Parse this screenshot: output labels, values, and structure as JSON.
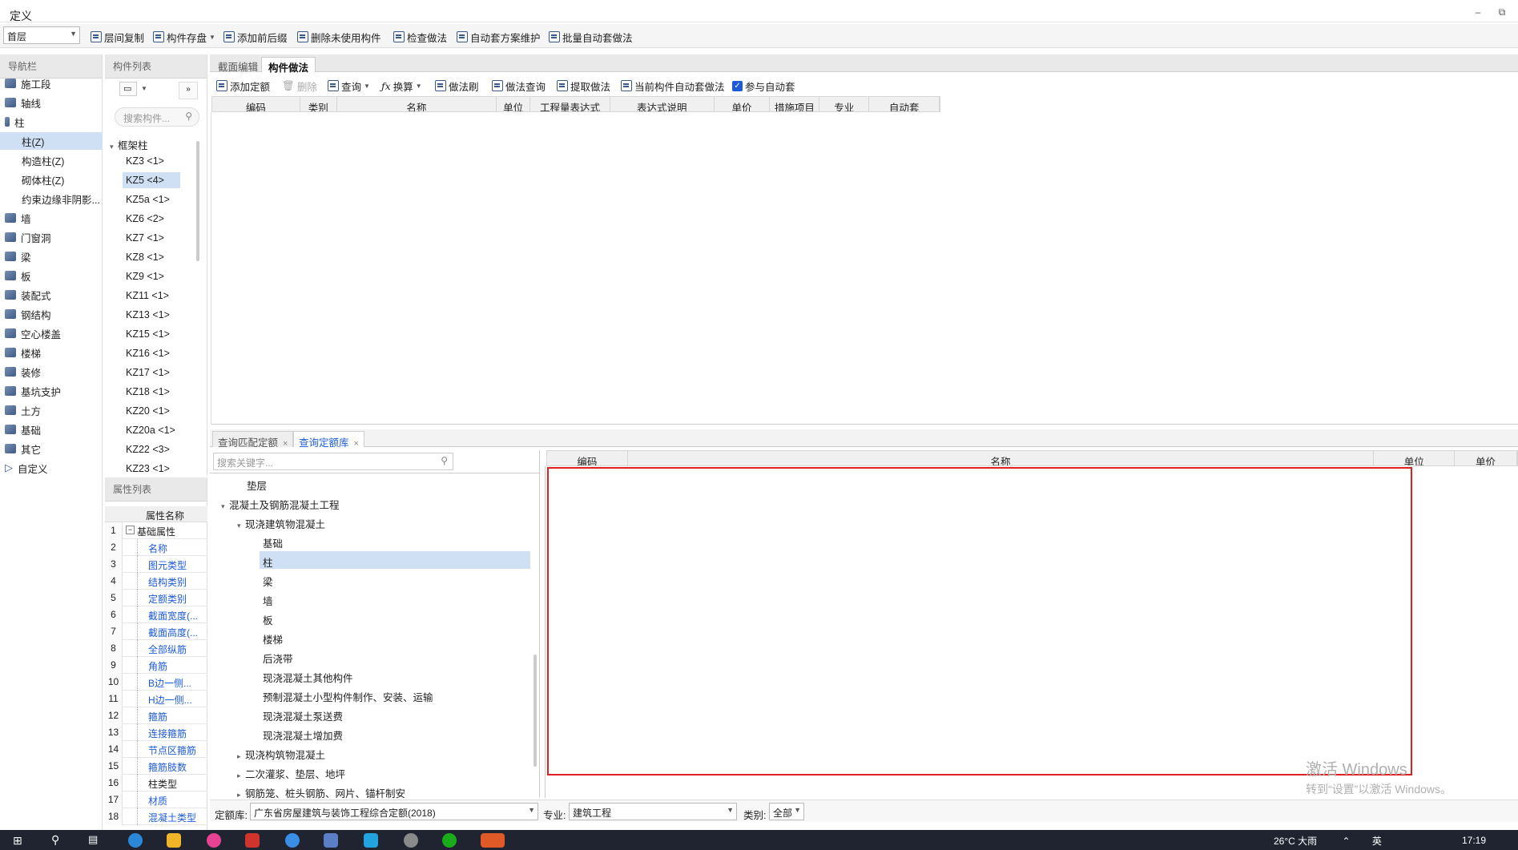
{
  "window": {
    "title": "定义",
    "minimize": "–",
    "restore": "⧉"
  },
  "toolbar": {
    "floor_select": "首层",
    "items": [
      "层间复制",
      "构件存盘",
      "添加前后缀",
      "删除未使用构件",
      "检查做法",
      "自动套方案维护",
      "批量自动套做法"
    ]
  },
  "nav": {
    "header": "导航栏",
    "items": [
      "施工段",
      "轴线",
      "柱",
      "柱(Z)",
      "构造柱(Z)",
      "砌体柱(Z)",
      "约束边缘非阴影...",
      "墙",
      "门窗洞",
      "梁",
      "板",
      "装配式",
      "钢结构",
      "空心楼盖",
      "楼梯",
      "装修",
      "基坑支护",
      "土方",
      "基础",
      "其它",
      "自定义"
    ]
  },
  "component_list": {
    "header": "构件列表",
    "search_placeholder": "搜索构件...",
    "group": "框架柱",
    "items": [
      "KZ3 <1>",
      "KZ5 <4>",
      "KZ5a <1>",
      "KZ6 <2>",
      "KZ7 <1>",
      "KZ8 <1>",
      "KZ9 <1>",
      "KZ11 <1>",
      "KZ13 <1>",
      "KZ15 <1>",
      "KZ16 <1>",
      "KZ17 <1>",
      "KZ18 <1>",
      "KZ20 <1>",
      "KZ20a <1>",
      "KZ22 <3>",
      "KZ23 <1>"
    ]
  },
  "properties": {
    "header": "属性列表",
    "column": "属性名称",
    "rows": [
      "基础属性",
      "名称",
      "图元类型",
      "结构类别",
      "定额类别",
      "截面宽度(...",
      "截面高度(...",
      "全部纵筋",
      "角筋",
      "B边一侧...",
      "H边一侧...",
      "箍筋",
      "连接箍筋",
      "节点区箍筋",
      "箍筋肢数",
      "柱类型",
      "材质",
      "混凝土类型"
    ],
    "numbers": [
      "1",
      "2",
      "3",
      "4",
      "5",
      "6",
      "7",
      "8",
      "9",
      "10",
      "11",
      "12",
      "13",
      "14",
      "15",
      "16",
      "17",
      "18"
    ]
  },
  "top_tabs": [
    "截面编辑",
    "构件做法"
  ],
  "actions": {
    "items": [
      "添加定额",
      "删除",
      "查询",
      "换算",
      "做法刷",
      "做法查询",
      "提取做法",
      "当前构件自动套做法"
    ],
    "checkbox_label": "参与自动套",
    "checked": true
  },
  "main_columns": [
    "编码",
    "类别",
    "名称",
    "单位",
    "工程量表达式",
    "表达式说明",
    "单价",
    "措施项目",
    "专业",
    "自动套"
  ],
  "bottom_tabs": [
    {
      "label": "查询匹配定额",
      "close": "×"
    },
    {
      "label": "查询定额库",
      "close": "×"
    }
  ],
  "query_tree": {
    "search_placeholder": "搜索关键字...",
    "rows": [
      "垫层",
      "混凝土及钢筋混凝土工程",
      "现浇建筑物混凝土",
      "基础",
      "柱",
      "梁",
      "墙",
      "板",
      "楼梯",
      "后浇带",
      "现浇混凝土其他构件",
      "预制混凝土小型构件制作、安装、运输",
      "现浇混凝土泵送费",
      "现浇混凝土增加费",
      "现浇构筑物混凝土",
      "二次灌浆、垫层、地坪",
      "钢筋笼、桩头钢筋、网片、锚杆制安"
    ]
  },
  "result_columns": [
    "编码",
    "名称",
    "单位",
    "单价"
  ],
  "footer": {
    "quota_label": "定额库:",
    "quota_value": "广东省房屋建筑与装饰工程综合定额(2018)",
    "major_label": "专业:",
    "major_value": "建筑工程",
    "cat_label": "类别:",
    "cat_value": "全部"
  },
  "watermark": {
    "line1": "激活 Windows",
    "line2": "转到“设置”以激活 Windows。"
  },
  "taskbar": {
    "time": "17:19",
    "weather": "26°C 大雨",
    "ime": "英"
  },
  "colors": {
    "selection": "#cfe0f5",
    "highlight_box": "#e02020",
    "link_blue": "#1d5bd6"
  }
}
